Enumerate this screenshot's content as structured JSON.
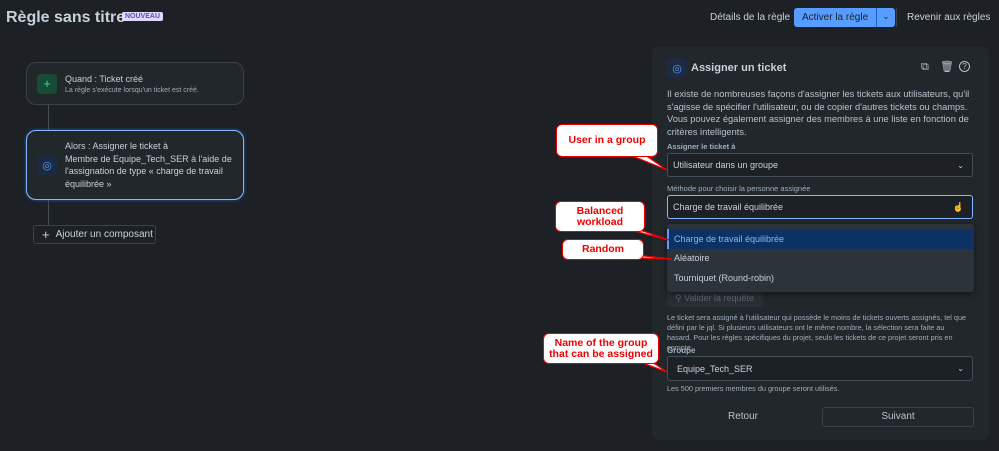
{
  "header": {
    "title": "Règle sans titre",
    "badge": "NOUVEAU",
    "details": "Détails de la règle",
    "activate": "Activer la règle",
    "back_to_rules": "Revenir aux règles"
  },
  "flow": {
    "trigger": {
      "title": "Quand : Ticket créé",
      "subtitle": "La règle s'exécute lorsqu'un ticket est créé."
    },
    "action": {
      "title": "Alors : Assigner le ticket à",
      "body": "Membre de Equipe_Tech_SER à l'aide de l'assignation de type « charge de travail équilibrée »"
    },
    "add": "Ajouter un composant"
  },
  "panel": {
    "title": "Assigner un ticket",
    "description": "Il existe de nombreuses façons d'assigner les tickets aux utilisateurs, qu'il s'agisse de spécifier l'utilisateur, ou de copier d'autres tickets ou champs. Vous pouvez également assigner des membres à une liste en fonction de critères intelligents.",
    "assign_label": "Assigner le ticket à",
    "assign_value": "Utilisateur dans un groupe",
    "method_label": "Méthode pour choisir la personne assignée",
    "method_value": "Charge de travail équilibrée",
    "options": [
      "Charge de travail équilibrée",
      "Aléatoire",
      "Tourniquet (Round-robin)"
    ],
    "validate": "Valider la requête",
    "help": "Le ticket sera assigné à l'utilisateur qui possède le moins de tickets ouverts assignés, tel que défini par le jql. Si plusieurs utilisateurs ont le même nombre, la sélection sera faite au hasard. Pour les règles spécifiques du projet, seuls les tickets de ce projet seront pris en compte.",
    "group_label": "Groupe",
    "group_value": "Equipe_Tech_SER",
    "group_note": "Les 500 premiers membres du groupe seront utilisés.",
    "back": "Retour",
    "next": "Suivant"
  },
  "callouts": {
    "c1": "User in a group",
    "c2": "Balanced workload",
    "c3": "Random",
    "c4": "Name of the group that can be assigned"
  }
}
